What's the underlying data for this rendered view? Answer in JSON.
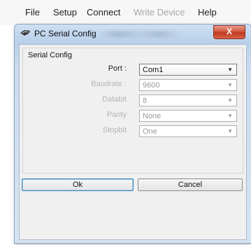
{
  "menu": [
    "File",
    "Setup",
    "Connect",
    "Write Device",
    "Help"
  ],
  "dialog": {
    "title": "PC Serial Config",
    "close_label": "X",
    "group_label": "Serial Config",
    "fields": [
      {
        "label": "Port :",
        "value": "Com1",
        "enabled": true
      },
      {
        "label": "Baudrate :",
        "value": "9600",
        "enabled": false
      },
      {
        "label": "Databit",
        "value": "8",
        "enabled": false
      },
      {
        "label": "Parity",
        "value": "None",
        "enabled": false
      },
      {
        "label": "Stopbit",
        "value": "One",
        "enabled": false
      }
    ],
    "ok_label": "Ok",
    "cancel_label": "Cancel"
  },
  "colors": {
    "close_button": "#c8472f",
    "title_bar": "#b9d0ea",
    "dialog_body": "#f0f0f0"
  }
}
